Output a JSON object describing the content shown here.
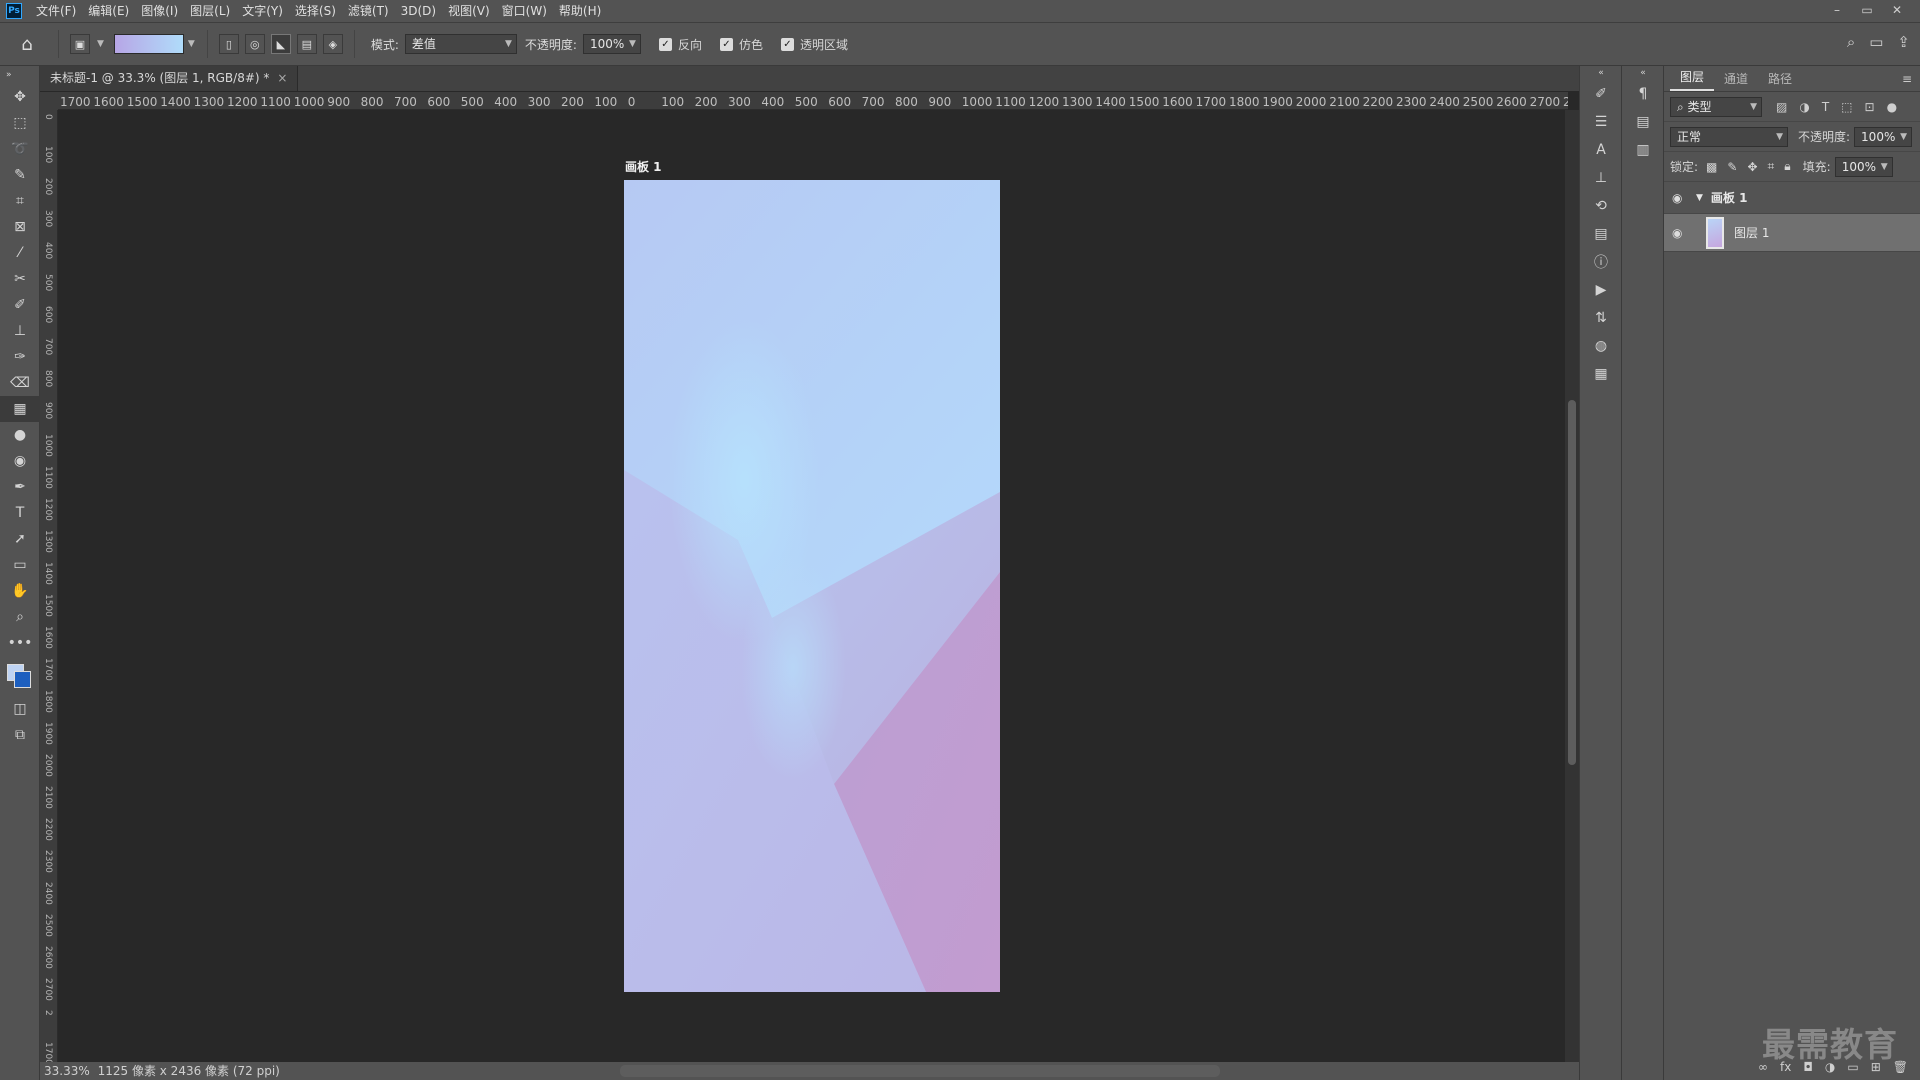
{
  "app": {
    "logo": "Ps"
  },
  "menu": [
    "文件(F)",
    "编辑(E)",
    "图像(I)",
    "图层(L)",
    "文字(Y)",
    "选择(S)",
    "滤镜(T)",
    "3D(D)",
    "视图(V)",
    "窗口(W)",
    "帮助(H)"
  ],
  "window_controls": [
    "–",
    "▭",
    "✕"
  ],
  "options": {
    "mode_label": "模式:",
    "mode_value": "差值",
    "opacity_label": "不透明度:",
    "opacity_value": "100%",
    "reverse_label": "反向",
    "dither_label": "仿色",
    "transparency_label": "透明区域",
    "reverse_checked": true,
    "dither_checked": true,
    "transparency_checked": true
  },
  "document": {
    "tab_title": "未标题-1 @ 33.3% (图层 1, RGB/8#) *",
    "artboard_label": "画板 1",
    "status_zoom": "33.33%",
    "status_info": "1125 像素 x 2436 像素 (72 ppi)",
    "canvas_colors": {
      "top": "#b7ccf5",
      "light": "#b4dcfb",
      "pink": "#c09ace",
      "lavender": "#b9bcea"
    }
  },
  "ruler": {
    "h_labels": [
      "1700",
      "1600",
      "1500",
      "1400",
      "1300",
      "1200",
      "1100",
      "1000",
      "900",
      "800",
      "700",
      "600",
      "500",
      "400",
      "300",
      "200",
      "100",
      "0",
      "100",
      "200",
      "300",
      "400",
      "500",
      "600",
      "700",
      "800",
      "900",
      "1000",
      "1100",
      "1200",
      "1300",
      "1400",
      "1500",
      "1600",
      "1700",
      "1800",
      "1900",
      "2000",
      "2100",
      "2200",
      "2300",
      "2400",
      "2500",
      "2600",
      "2700",
      "2"
    ]
  },
  "colors": {
    "foreground": "#bed3f3",
    "background": "#1d5fbf"
  },
  "layers_panel": {
    "tabs": [
      "图层",
      "通道",
      "路径"
    ],
    "filter_label": "类型",
    "blend_mode": "正常",
    "opacity_label": "不透明度:",
    "opacity_value": "100%",
    "lock_label": "锁定:",
    "fill_label": "填充:",
    "fill_value": "100%",
    "group_name": "画板 1",
    "layer_name": "图层 1"
  },
  "watermark": "最需教育"
}
